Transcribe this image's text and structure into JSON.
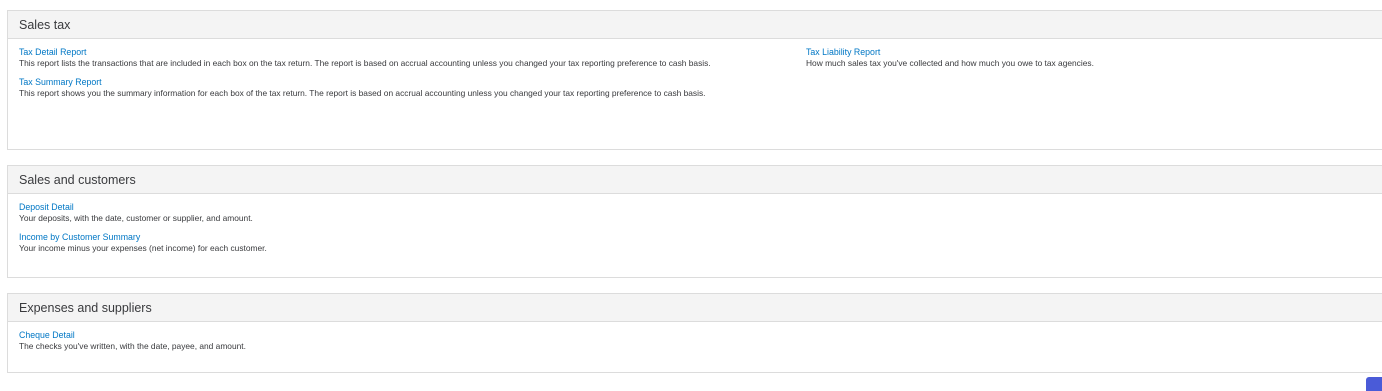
{
  "sections": [
    {
      "title": "Sales tax",
      "left": [
        {
          "link": "Tax Detail Report",
          "desc": "This report lists the transactions that are included in each box on the tax return. The report is based on accrual accounting unless you changed your tax reporting preference to cash basis."
        },
        {
          "link": "Tax Summary Report",
          "desc": "This report shows you the summary information for each box of the tax return. The report is based on accrual accounting unless you changed your tax reporting preference to cash basis."
        }
      ],
      "right": [
        {
          "link": "Tax Liability Report",
          "desc": "How much sales tax you've collected and how much you owe to tax agencies."
        }
      ]
    },
    {
      "title": "Sales and customers",
      "left": [
        {
          "link": "Deposit Detail",
          "desc": "Your deposits, with the date, customer or supplier, and amount."
        },
        {
          "link": "Income by Customer Summary",
          "desc": "Your income minus your expenses (net income) for each customer."
        }
      ]
    },
    {
      "title": "Expenses and suppliers",
      "left": [
        {
          "link": "Cheque Detail",
          "desc": "The checks you've written, with the date, payee, and amount."
        }
      ]
    }
  ],
  "colors": {
    "link": "#0077c5",
    "header_bg": "#f4f4f4",
    "border": "#dcdcdc",
    "fab": "#4a5bd8"
  }
}
